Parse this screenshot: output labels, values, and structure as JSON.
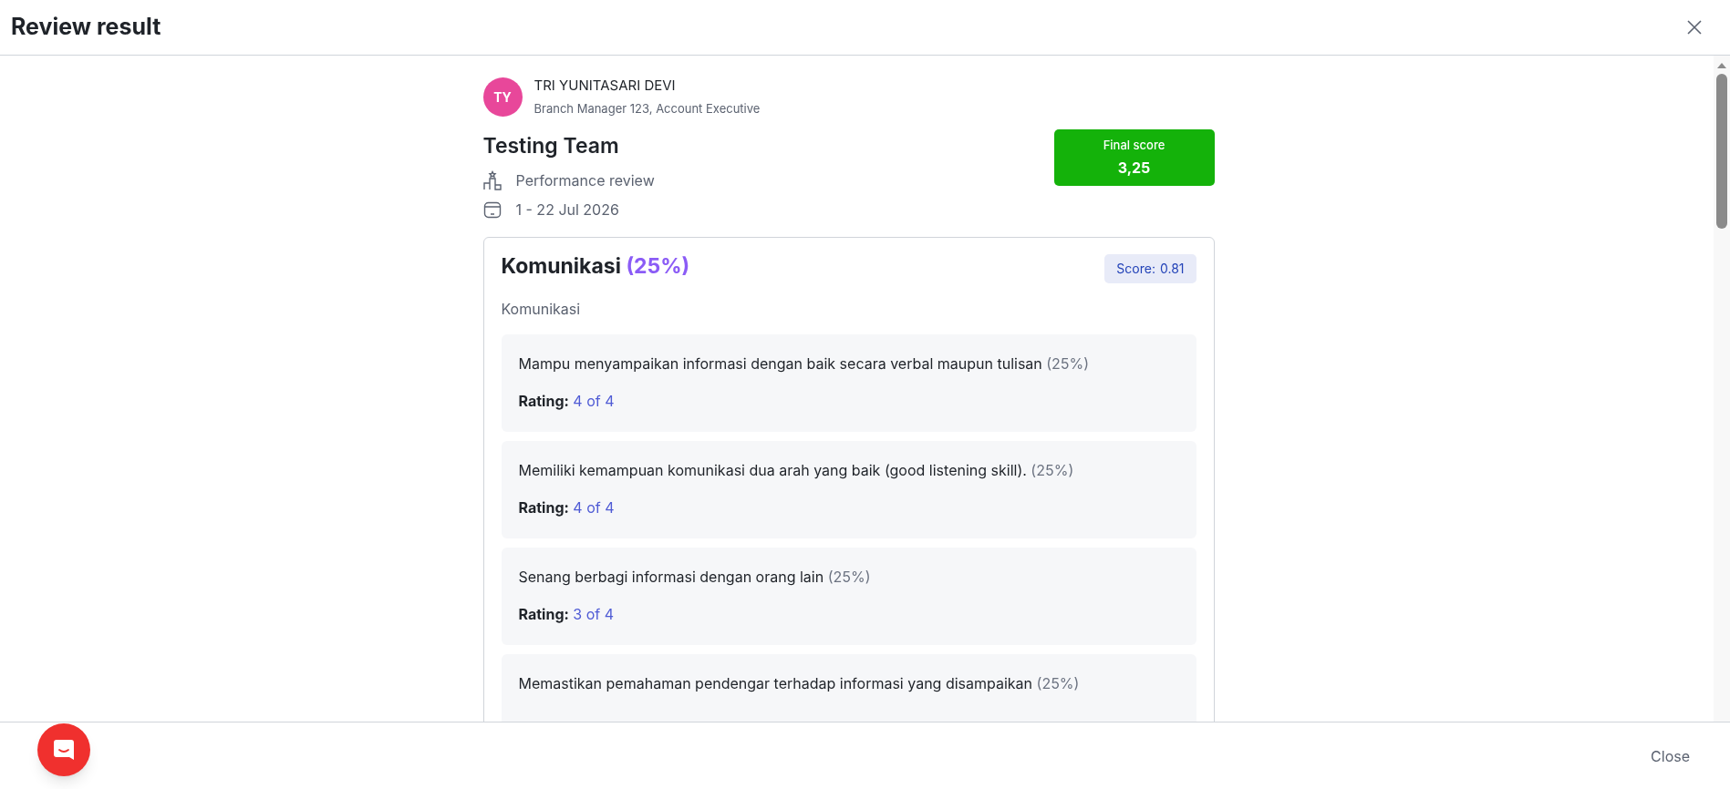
{
  "header": {
    "title": "Review result"
  },
  "employee": {
    "initials": "TY",
    "name": "TRI YUNITASARI DEVI",
    "position": "Branch Manager 123, Account Executive"
  },
  "review": {
    "team": "Testing Team",
    "type": "Performance review",
    "period": "1 - 22 Jul 2026"
  },
  "final_score": {
    "label": "Final score",
    "value": "3,25"
  },
  "section": {
    "title": "Komunikasi",
    "weight": "(25%)",
    "score_label": "Score:",
    "score": "0.81",
    "description": "Komunikasi",
    "items": [
      {
        "text": "Mampu menyampaikan informasi dengan baik secara verbal maupun tulisan",
        "weight": "(25%)",
        "rating_label": "Rating:",
        "rating": "4 of 4"
      },
      {
        "text": "Memiliki kemampuan komunikasi dua arah yang baik (good listening skill).",
        "weight": "(25%)",
        "rating_label": "Rating:",
        "rating": "4 of 4"
      },
      {
        "text": "Senang berbagi informasi dengan orang lain",
        "weight": "(25%)",
        "rating_label": "Rating:",
        "rating": "3 of 4"
      },
      {
        "text": "Memastikan pemahaman pendengar terhadap informasi yang disampaikan",
        "weight": "(25%)"
      }
    ]
  },
  "footer": {
    "close": "Close"
  }
}
